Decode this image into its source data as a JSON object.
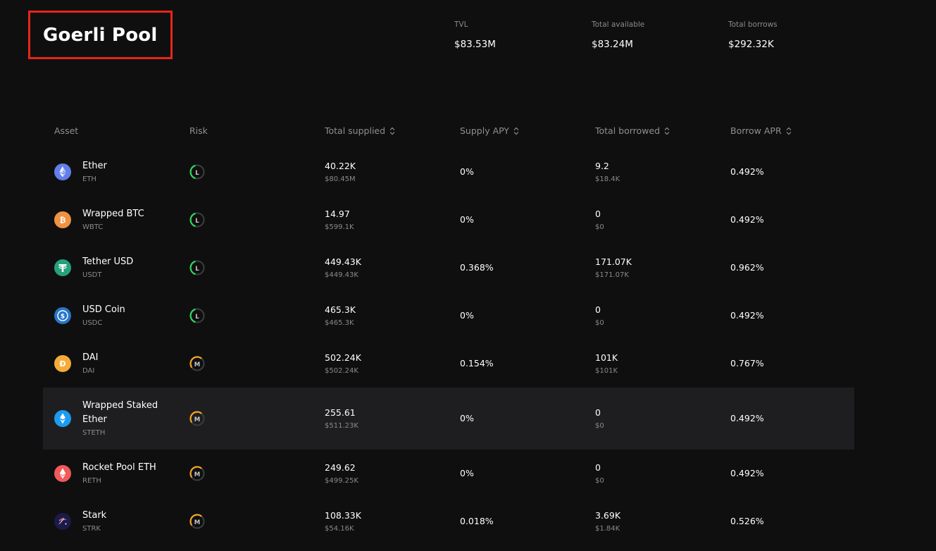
{
  "pool": {
    "title": "Goerli Pool"
  },
  "stats": [
    {
      "label": "TVL",
      "value": "$83.53M"
    },
    {
      "label": "Total available",
      "value": "$83.24M"
    },
    {
      "label": "Total borrows",
      "value": "$292.32K"
    }
  ],
  "table": {
    "headers": {
      "asset": "Asset",
      "risk": "Risk",
      "supplied": "Total supplied",
      "supply_apy": "Supply APY",
      "borrowed": "Total borrowed",
      "borrow_apr": "Borrow APR"
    },
    "rows": [
      {
        "name": "Ether",
        "symbol": "ETH",
        "icon": "eth-icon",
        "icon_color": "#627eea",
        "risk": "L",
        "risk_color": "#2fd85a",
        "supplied": "40.22K",
        "supplied_usd": "$80.45M",
        "supply_apy": "0%",
        "borrowed": "9.2",
        "borrowed_usd": "$18.4K",
        "borrow_apr": "0.492%"
      },
      {
        "name": "Wrapped BTC",
        "symbol": "WBTC",
        "icon": "wbtc-icon",
        "icon_color": "#f09242",
        "risk": "L",
        "risk_color": "#2fd85a",
        "supplied": "14.97",
        "supplied_usd": "$599.1K",
        "supply_apy": "0%",
        "borrowed": "0",
        "borrowed_usd": "$0",
        "borrow_apr": "0.492%"
      },
      {
        "name": "Tether USD",
        "symbol": "USDT",
        "icon": "usdt-icon",
        "icon_color": "#26a17b",
        "risk": "L",
        "risk_color": "#2fd85a",
        "supplied": "449.43K",
        "supplied_usd": "$449.43K",
        "supply_apy": "0.368%",
        "borrowed": "171.07K",
        "borrowed_usd": "$171.07K",
        "borrow_apr": "0.962%"
      },
      {
        "name": "USD Coin",
        "symbol": "USDC",
        "icon": "usdc-icon",
        "icon_color": "#2775ca",
        "risk": "L",
        "risk_color": "#2fd85a",
        "supplied": "465.3K",
        "supplied_usd": "$465.3K",
        "supply_apy": "0%",
        "borrowed": "0",
        "borrowed_usd": "$0",
        "borrow_apr": "0.492%"
      },
      {
        "name": "DAI",
        "symbol": "DAI",
        "icon": "dai-icon",
        "icon_color": "#f5ac37",
        "risk": "M",
        "risk_color": "#f5a623",
        "supplied": "502.24K",
        "supplied_usd": "$502.24K",
        "supply_apy": "0.154%",
        "borrowed": "101K",
        "borrowed_usd": "$101K",
        "borrow_apr": "0.767%"
      },
      {
        "name_line1": "Wrapped Staked",
        "name_line2": "Ether",
        "symbol": "STETH",
        "icon": "steth-icon",
        "icon_color": "#1d9bf0",
        "risk": "M",
        "risk_color": "#f5a623",
        "supplied": "255.61",
        "supplied_usd": "$511.23K",
        "supply_apy": "0%",
        "borrowed": "0",
        "borrowed_usd": "$0",
        "borrow_apr": "0.492%"
      },
      {
        "name": "Rocket Pool ETH",
        "symbol": "RETH",
        "icon": "reth-icon",
        "icon_color": "#f05a5a",
        "risk": "M",
        "risk_color": "#f5a623",
        "supplied": "249.62",
        "supplied_usd": "$499.25K",
        "supply_apy": "0%",
        "borrowed": "0",
        "borrowed_usd": "$0",
        "borrow_apr": "0.492%"
      },
      {
        "name": "Stark",
        "symbol": "STRK",
        "icon": "stark-icon",
        "icon_color": "#1b1a4a",
        "risk": "M",
        "risk_color": "#f5a623",
        "supplied": "108.33K",
        "supplied_usd": "$54.16K",
        "supply_apy": "0.018%",
        "borrowed": "3.69K",
        "borrowed_usd": "$1.84K",
        "borrow_apr": "0.526%"
      }
    ]
  }
}
